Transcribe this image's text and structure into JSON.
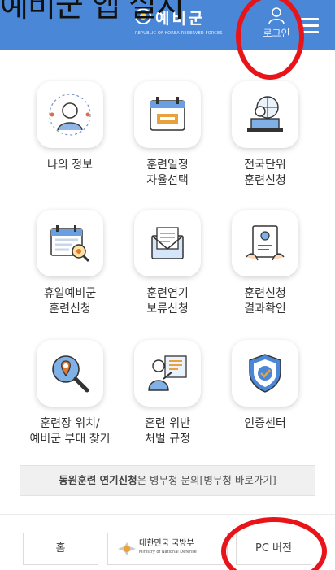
{
  "overlay_caption": "예비군 앱 실지",
  "header": {
    "brand_name": "예비군",
    "brand_subtitle": "REPUBLIC OF KOREA RESERVED FORCES",
    "login_label": "로그인",
    "accent_color": "#4a87d6"
  },
  "menu": {
    "items": [
      {
        "label": "나의 정보",
        "icon": "user-profile-icon"
      },
      {
        "label": "훈련일정\n자율선택",
        "icon": "calendar-icon"
      },
      {
        "label": "전국단위\n훈련신청",
        "icon": "globe-laptop-icon"
      },
      {
        "label": "휴일예비군\n훈련신청",
        "icon": "calendar-search-icon"
      },
      {
        "label": "훈련연기\n보류신청",
        "icon": "envelope-icon"
      },
      {
        "label": "훈련신청\n결과확인",
        "icon": "result-document-icon"
      },
      {
        "label": "훈련장 위치/\n예비군 부대 찾기",
        "icon": "location-search-icon"
      },
      {
        "label": "훈련 위반\n처벌 규정",
        "icon": "presenter-icon"
      },
      {
        "label": "인증센터",
        "icon": "shield-check-icon"
      }
    ]
  },
  "notice": {
    "bold": "동원훈련 연기신청",
    "rest": "은 병무청 문의[병무청 바로가기]"
  },
  "footer": {
    "home_label": "홈",
    "mnd_name": "대한민국 국방부",
    "mnd_sub": "Ministry of National Defense",
    "pc_label": "PC 버전"
  }
}
